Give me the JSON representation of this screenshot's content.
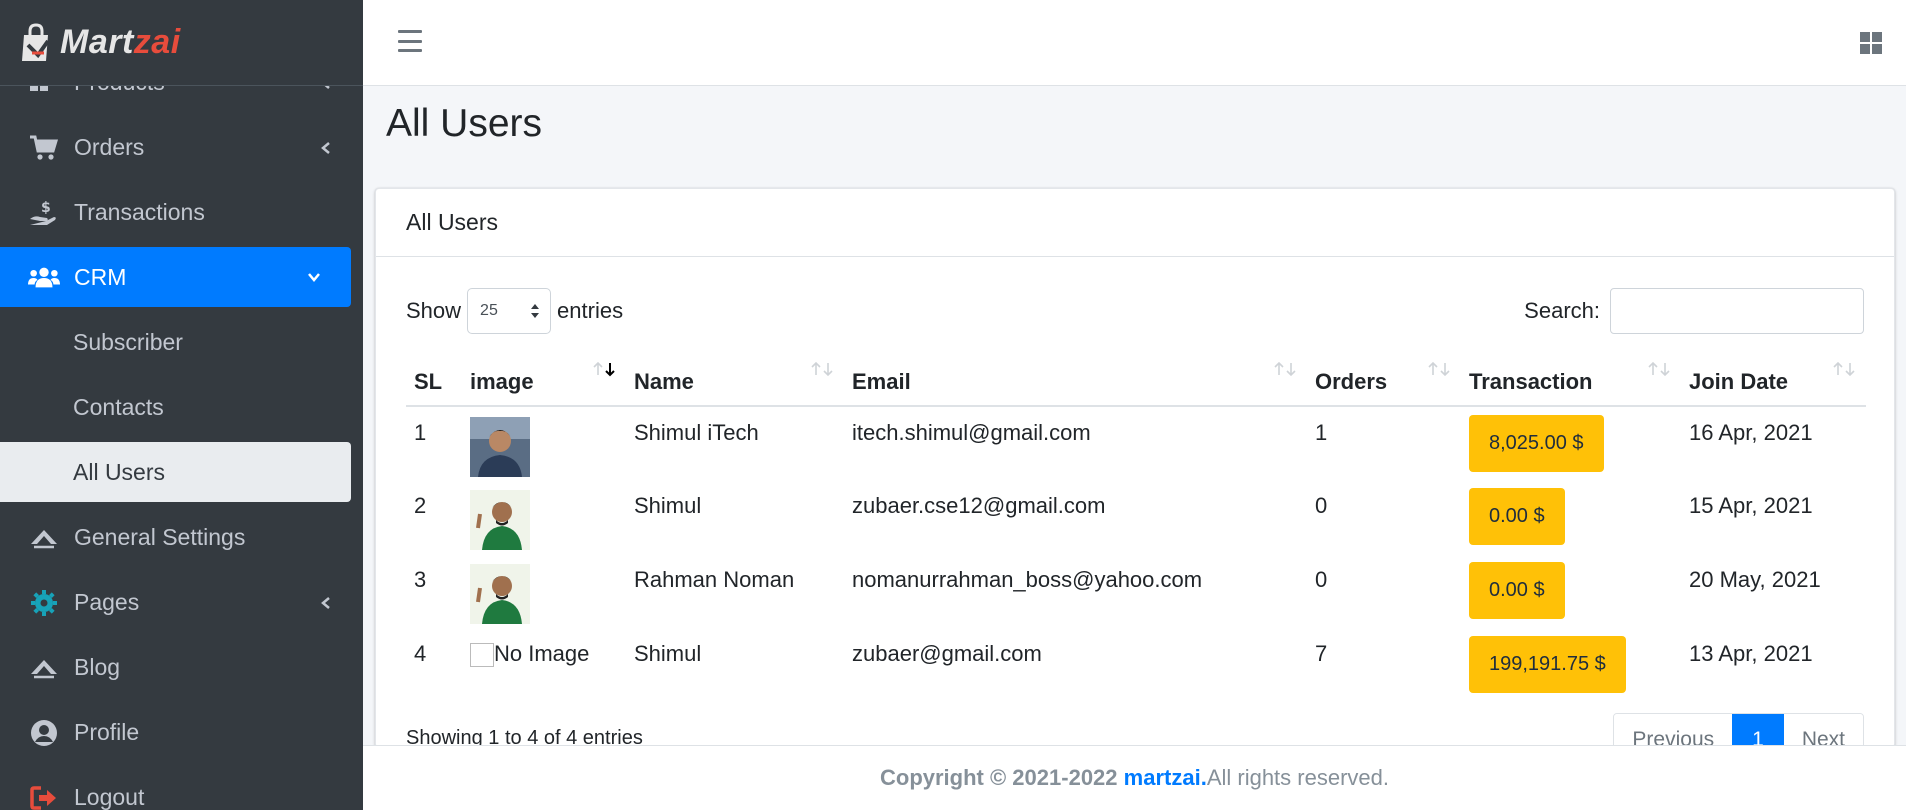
{
  "brand": {
    "name_main": "Mart",
    "name_accent": "zai",
    "accent_color": "#e74c3c"
  },
  "sidebar": {
    "items": [
      {
        "label": "Products",
        "icon": "products-icon"
      },
      {
        "label": "Orders",
        "icon": "cart-icon"
      },
      {
        "label": "Transactions",
        "icon": "hand-dollar-icon"
      },
      {
        "label": "CRM",
        "icon": "users-icon"
      },
      {
        "label": "Subscriber"
      },
      {
        "label": "Contacts"
      },
      {
        "label": "All Users"
      },
      {
        "label": "General Settings",
        "icon": "settings-icon"
      },
      {
        "label": "Pages",
        "icon": "gear-icon"
      },
      {
        "label": "Blog",
        "icon": "blog-icon"
      },
      {
        "label": "Profile",
        "icon": "user-circle-icon"
      },
      {
        "label": "Logout",
        "icon": "logout-icon"
      }
    ]
  },
  "page": {
    "title": "All Users"
  },
  "card": {
    "title": "All Users"
  },
  "controls": {
    "show_label": "Show",
    "entries_value": "25",
    "entries_label": "entries",
    "search_label": "Search:"
  },
  "table": {
    "headers": [
      "SL",
      "image",
      "Name",
      "Email",
      "Orders",
      "Transaction",
      "Join Date"
    ],
    "rows": [
      {
        "sl": "1",
        "image": "photo",
        "name": "Shimul iTech",
        "email": "itech.shimul@gmail.com",
        "orders": "1",
        "transaction": "8,025.00 $",
        "join_date": "16 Apr, 2021"
      },
      {
        "sl": "2",
        "image": "photo",
        "name": "Shimul",
        "email": "zubaer.cse12@gmail.com",
        "orders": "0",
        "transaction": "0.00 $",
        "join_date": "15 Apr, 2021"
      },
      {
        "sl": "3",
        "image": "photo",
        "name": "Rahman Noman",
        "email": "nomanurrahman_boss@yahoo.com",
        "orders": "0",
        "transaction": "0.00 $",
        "join_date": "20 May, 2021"
      },
      {
        "sl": "4",
        "image": "No Image",
        "name": "Shimul",
        "email": "zubaer@gmail.com",
        "orders": "7",
        "transaction": "199,191.75 $",
        "join_date": "13 Apr, 2021"
      }
    ]
  },
  "footer_table": {
    "info": "Showing 1 to 4 of 4 entries",
    "prev": "Previous",
    "page": "1",
    "next": "Next"
  },
  "footer": {
    "copyright": "Copyright © 2021-2022 ",
    "brand": "martzai.",
    "rights": " All rights reserved."
  },
  "colors": {
    "primary": "#007bff",
    "warning": "#ffc107",
    "sidebar_bg": "#343a40"
  }
}
